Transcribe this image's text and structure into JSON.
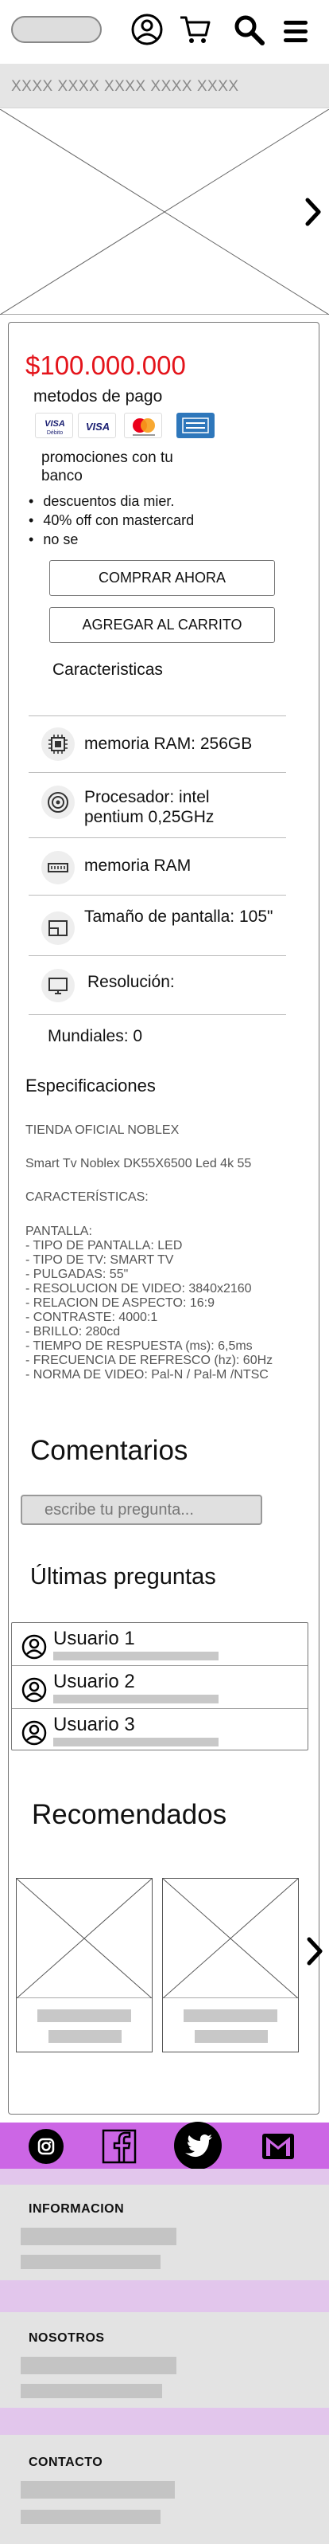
{
  "header": {
    "search_placeholder": "",
    "icons": [
      "user-icon",
      "cart-icon",
      "search-icon",
      "menu-icon"
    ]
  },
  "breadcrumb": "XXXX XXXX XXXX XXXX XXXX",
  "product": {
    "price": "$100.000.000",
    "payment_title": "metodos de pago",
    "cards": [
      "visa-debito-icon",
      "visa-icon",
      "mastercard-icon",
      "amex-icon"
    ],
    "card_labels": {
      "visa_debito": "VISA",
      "visa_debito_sub": "Débito",
      "visa": "VISA"
    },
    "promo_line1": "promociones con tu",
    "promo_line2": "banco",
    "bullets": [
      "descuentos dia mier.",
      "40% off con mastercard",
      "no se"
    ],
    "buy_now": "COMPRAR AHORA",
    "add_to_cart": "AGREGAR AL CARRITO",
    "characteristics_title": "Caracteristicas"
  },
  "characteristics": [
    {
      "icon": "chip-icon",
      "line1": "memoria RAM: 256GB",
      "line2": ""
    },
    {
      "icon": "processor-icon",
      "line1": "Procesador: intel",
      "line2": "pentium 0,25GHz"
    },
    {
      "icon": "ram-icon",
      "line1": "memoria RAM",
      "line2": ""
    },
    {
      "icon": "screen-size-icon",
      "line1": "Tamaño de pantalla: 105\"",
      "line2": ""
    },
    {
      "icon": "resolution-icon",
      "line1": "Resolución:",
      "line2": ""
    },
    {
      "icon": "",
      "line1": "Mundiales: 0",
      "line2": ""
    }
  ],
  "specs": {
    "title": "Especificaciones",
    "store": "TIENDA OFICIAL NOBLEX",
    "model": "Smart Tv Noblex DK55X6500 Led 4k 55",
    "features_heading": "CARACTERÍSTICAS:",
    "details": "PANTALLA:\n- TIPO DE PANTALLA: LED\n- TIPO DE TV: SMART TV\n- PULGADAS: 55\"\n- RESOLUCION DE VIDEO: 3840x2160\n- RELACION DE ASPECTO: 16:9\n- CONTRASTE: 4000:1\n- BRILLO: 280cd\n- TIEMPO DE RESPUESTA (ms): 6,5ms\n- FRECUENCIA DE REFRESCO (hz): 60Hz\n- NORMA DE VIDEO: Pal-N / Pal-M /NTSC"
  },
  "comments": {
    "title": "Comentarios",
    "placeholder": "escribe tu pregunta...",
    "last_title": "Últimas preguntas",
    "users": [
      "Usuario 1",
      "Usuario 2",
      "Usuario 3"
    ]
  },
  "recommended": {
    "title": "Recomendados"
  },
  "social": [
    "instagram-icon",
    "facebook-icon",
    "twitter-icon",
    "gmail-icon"
  ],
  "footer": {
    "info": "INFORMACION",
    "about": "NOSOTROS",
    "contact": "CONTACTO"
  },
  "colors": {
    "price": "#e4141b",
    "social_bar": "#cc66e5",
    "footer_strip": "#e2c6ec",
    "footer_bg": "#e3e3e3"
  }
}
